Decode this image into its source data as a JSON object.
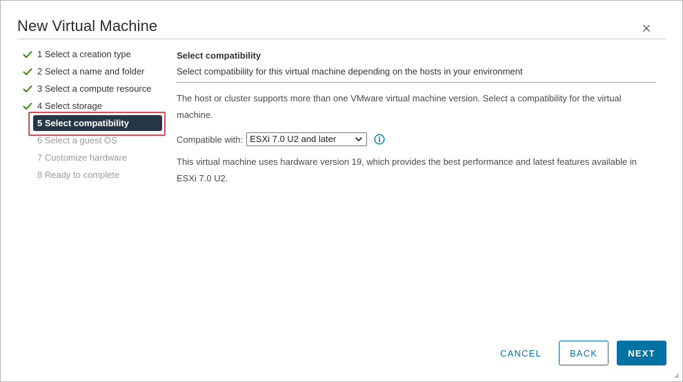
{
  "dialog": {
    "title": "New Virtual Machine",
    "close_icon": "close-icon"
  },
  "steps": [
    {
      "label": "1 Select a creation type",
      "status": "done"
    },
    {
      "label": "2 Select a name and folder",
      "status": "done"
    },
    {
      "label": "3 Select a compute resource",
      "status": "done"
    },
    {
      "label": "4 Select storage",
      "status": "done"
    },
    {
      "label": "5 Select compatibility",
      "status": "active"
    },
    {
      "label": "6 Select a guest OS",
      "status": "pending"
    },
    {
      "label": "7 Customize hardware",
      "status": "pending"
    },
    {
      "label": "8 Ready to complete",
      "status": "pending"
    }
  ],
  "content": {
    "section_title": "Select compatibility",
    "section_desc": "Select compatibility for this virtual machine depending on the hosts in your environment",
    "intro": "The host or cluster supports more than one VMware virtual machine version. Select a compatibility for the virtual machine.",
    "compat_label": "Compatible with:",
    "compat_value": "ESXi 7.0 U2 and later",
    "info_icon": "info-icon",
    "hardware_note": "This virtual machine uses hardware version 19, which provides the best performance and latest features available in ESXi 7.0 U2."
  },
  "footer": {
    "cancel_label": "CANCEL",
    "back_label": "BACK",
    "next_label": "NEXT"
  },
  "colors": {
    "accent": "#0072a3",
    "active_step_bg": "#253746",
    "check_green": "#3c8500",
    "highlight_red": "#e0474f"
  }
}
